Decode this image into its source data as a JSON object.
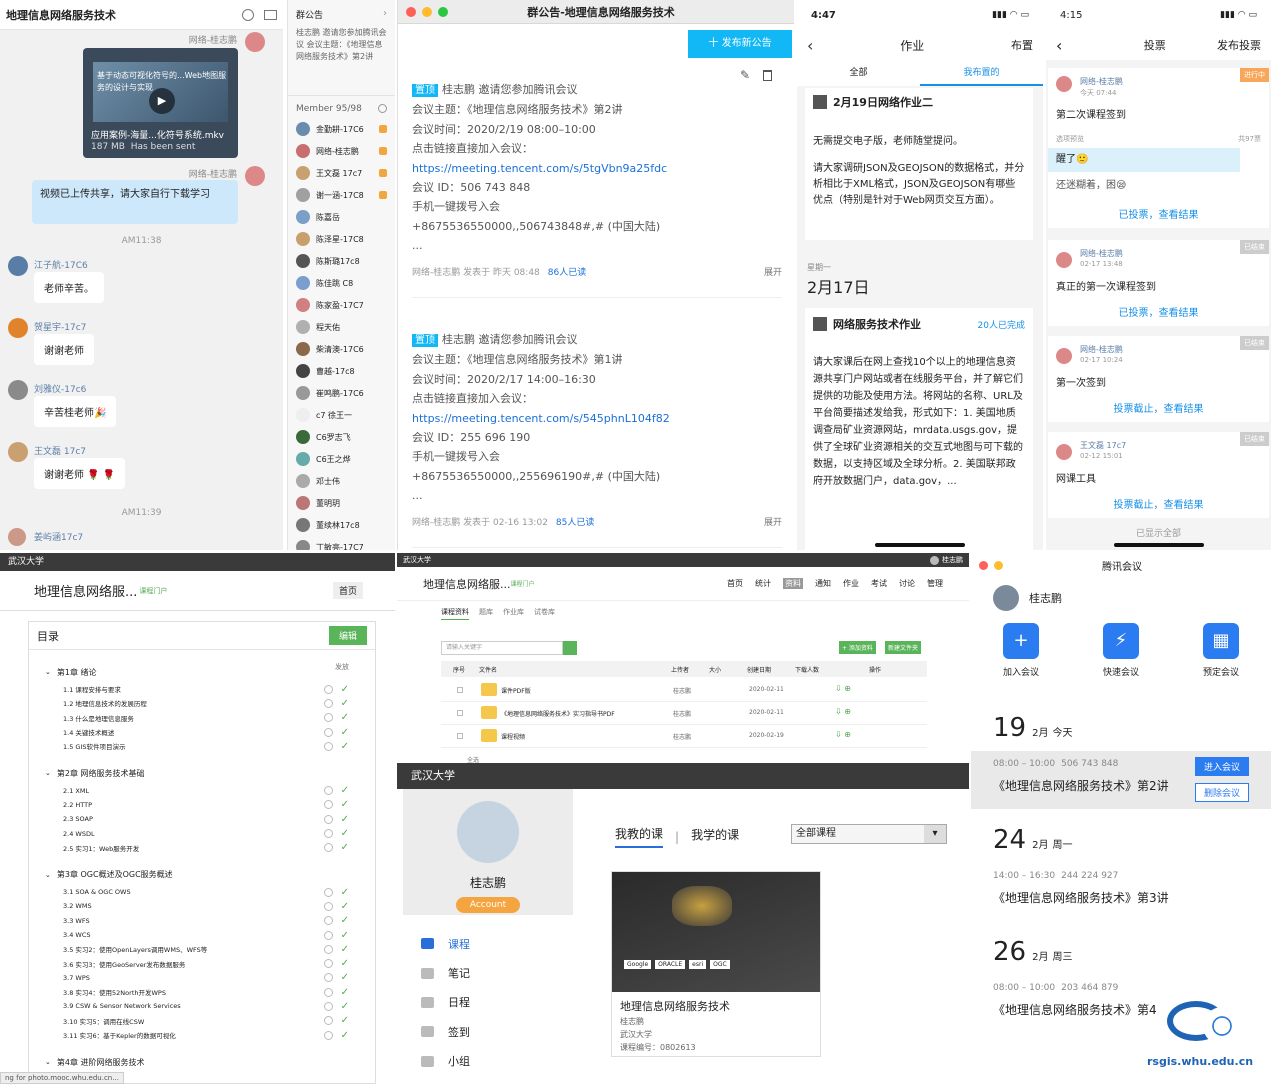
{
  "chat": {
    "title": "地理信息网络服务技术",
    "sender1": "网络-桂志鹏",
    "video_overlay": "基于动态可视化符号的...Web地图服务的设计与实现",
    "video_name": "应用案例-海量...化符号系统.mkv",
    "video_size": "187 MB",
    "video_status": "Has been sent",
    "sender2": "网络-桂志鹏",
    "msg1": "视频已上传共享，请大家自行下载学习",
    "time1": "AM11:38",
    "msgs": [
      {
        "name": "江子航-17C6",
        "text": "老师辛苦。",
        "color": "#5a7da8"
      },
      {
        "name": "贺星宇-17c7",
        "text": "谢谢老师",
        "color": "#e0842c"
      },
      {
        "name": "刘雅仪-17c6",
        "text": "辛苦桂老师🎉",
        "color": "#8a8a8a"
      },
      {
        "name": "王文磊 17c7",
        "text": "谢谢老师 🌹 🌹",
        "color": "#c9a070"
      }
    ],
    "time2": "AM11:39",
    "last_name": "姜屿涵17c7"
  },
  "members": {
    "title": "群公告",
    "notice": "桂志鹏 邀请您参加腾讯会议 会议主题：《地理信息网络服务技术》第2讲",
    "count_label": "Member 95/98",
    "list": [
      {
        "name": "金勤耕-17C6",
        "c": "#6b8cae",
        "crown": true
      },
      {
        "name": "网络-桂志鹏",
        "c": "#c86e6e",
        "crown": true
      },
      {
        "name": "王文磊 17c7",
        "c": "#c9a070",
        "crown": true
      },
      {
        "name": "谢一涵-17C8",
        "c": "#a0a0a0",
        "crown": true
      },
      {
        "name": "陈嘉岳",
        "c": "#7aa0c8",
        "crown": false
      },
      {
        "name": "陈泽星-17C8",
        "c": "#c8a06e",
        "crown": false
      },
      {
        "name": "陈斯璐17c8",
        "c": "#555",
        "crown": false
      },
      {
        "name": "陈佳跳 C8",
        "c": "#7a9ecf",
        "crown": false
      },
      {
        "name": "陈家盈-17C7",
        "c": "#d08080",
        "crown": false
      },
      {
        "name": "程天佑",
        "c": "#b0b0b0",
        "crown": false
      },
      {
        "name": "柴清澳-17C6",
        "c": "#8a6a4a",
        "crown": false
      },
      {
        "name": "曹越-17c8",
        "c": "#444",
        "crown": false
      },
      {
        "name": "崔鸣鹏-17C6",
        "c": "#999",
        "crown": false
      },
      {
        "name": "c7 徐王一",
        "c": "#eee",
        "crown": false
      },
      {
        "name": "C6罗志飞",
        "c": "#3a6a3a",
        "crown": false
      },
      {
        "name": "C6王之烨",
        "c": "#6aa",
        "crown": false
      },
      {
        "name": "邓士伟",
        "c": "#aaa",
        "crown": false
      },
      {
        "name": "董明玥",
        "c": "#b77",
        "crown": false
      },
      {
        "name": "董续林17c8",
        "c": "#777",
        "crown": false
      },
      {
        "name": "丁敏亮-17C7",
        "c": "#888",
        "crown": false
      }
    ]
  },
  "announce": {
    "title": "群公告-地理信息网络服务技术",
    "publish_btn": "十 发布新公告",
    "items": [
      {
        "pin": "置顶",
        "head": "桂志鹏 邀请您参加腾讯会议",
        "topic": "会议主题：《地理信息网络服务技术》第2讲",
        "time": "会议时间：2020/2/19 08:00–10:00",
        "join": "点击链接直接加入会议：",
        "link": "https://meeting.tencent.com/s/5tgVbn9a25fdc",
        "id": "会议 ID：506 743 848",
        "phone": "手机一键拨号入会",
        "num": "+8675536550000,,506743848#,# (中国大陆)",
        "more": "...",
        "footer": "网络-桂志鹏 发表于 昨天 08:48",
        "read": "86人已读",
        "expand": "展开"
      },
      {
        "pin": "置顶",
        "head": "桂志鹏 邀请您参加腾讯会议",
        "topic": "会议主题：《地理信息网络服务技术》第1讲",
        "time": "会议时间：2020/2/17 14:00–16:30",
        "join": "点击链接直接加入会议：",
        "link": "https://meeting.tencent.com/s/545phnL104f82",
        "id": "会议 ID：255 696 190",
        "phone": "手机一键拨号入会",
        "num": "+8675536550000,,255696190#,# (中国大陆)",
        "more": "...",
        "footer": "网络-桂志鹏 发表于 02-16 13:02",
        "read": "85人已读",
        "expand": "展开"
      }
    ]
  },
  "homework": {
    "time": "4:47",
    "title": "作业",
    "right": "布置",
    "tab_all": "全部",
    "tab_mine": "我布置的",
    "card1_title": "2月19日网络作业二",
    "card1_p1": "无需提交电子版，老师随堂提问。",
    "card1_p2": "请大家调研JSON及GEOJSON的数据格式，并分析相比于XML格式，JSON及GEOJSON有哪些优点（特别是针对于Web网页交互方面）。",
    "weekday": "星期一",
    "date": "2月17日",
    "card2_title": "网络服务技术作业",
    "card2_done": "20人已完成",
    "card2_body": "请大家课后在网上查找10个以上的地理信息资源共享门户网站或者在线服务平台，并了解它们提供的功能及使用方法。将网站的名称、URL及平台简要描述发给我，形式如下：1. 美国地质调查局矿业资源网站，mrdata.usgs.gov，提供了全球矿业资源相关的交互式地图与可下载的数据，以支持区域及全球分析。2. 美国联邦政府开放数据门户，data.gov，..."
  },
  "vote": {
    "time": "4:15",
    "title": "投票",
    "right": "发布投票",
    "v1_author": "网络-桂志鹏",
    "v1_time": "今天 07:44",
    "v1_status": "进行中",
    "v1_title": "第二次课程签到",
    "v1_preview": "选项预览",
    "v1_total": "共97票",
    "v1_opt1": "醒了🙂",
    "v1_opt2": "还迷糊着，困😪",
    "v1_link": "已投票，查看结果",
    "items": [
      {
        "author": "网络-桂志鹏",
        "time": "02-17 13:48",
        "status": "已结束",
        "title": "真正的第一次课程签到",
        "link": "已投票，查看结果"
      },
      {
        "author": "网络-桂志鹏",
        "time": "02-17 10:24",
        "status": "已结束",
        "title": "第一次签到",
        "link": "投票截止，查看结果"
      },
      {
        "author": "王文磊 17c7",
        "time": "02-12 15:01",
        "status": "已结束",
        "title": "网课工具",
        "link": "投票截止，查看结果"
      }
    ],
    "shown_all": "已显示全部"
  },
  "outline": {
    "school": "武汉大学",
    "course": "地理信息网络服...",
    "course_tag": "课程门户",
    "home": "首页",
    "toc": "目录",
    "edit": "编辑",
    "publish_col": "发放",
    "chapters": [
      {
        "title": "第1章 绪论",
        "items": [
          "1.1 课程安排与要求",
          "1.2 地理信息技术的发展历程",
          "1.3 什么是地理信息服务",
          "1.4 关键技术概述",
          "1.5 GIS软件项目演示"
        ]
      },
      {
        "title": "第2章 网络服务技术基础",
        "items": [
          "2.1 XML",
          "2.2 HTTP",
          "2.3 SOAP",
          "2.4 WSDL",
          "2.5 实习1：Web服务开发"
        ]
      },
      {
        "title": "第3章 OGC概述及OGC服务概述",
        "items": [
          "3.1 SOA & OGC OWS",
          "3.2 WMS",
          "3.3 WFS",
          "3.4 WCS",
          "3.5 实习2：使用OpenLayers调用WMS、WFS等",
          "3.6 实习3：使用GeoServer发布数据服务",
          "3.7 WPS",
          "3.8 实习4：使用52North开发WPS",
          "3.9 CSW & Sensor Network Services",
          "3.10 实习5：调用在线CSW",
          "3.11 实习6：基于Kepler的数据可视化"
        ]
      },
      {
        "title": "第4章 进阶网络服务技术",
        "items": []
      }
    ],
    "status": "ng for photo.mooc.whu.edu.cn..."
  },
  "files": {
    "school": "武汉大学",
    "user": "桂志鹏",
    "course": "地理信息网络服...",
    "course_tag": "课程门户",
    "nav": [
      "首页",
      "统计",
      "资料",
      "通知",
      "作业",
      "考试",
      "讨论",
      "管理"
    ],
    "subtabs": [
      "课程资料",
      "题库",
      "作业库",
      "试卷库"
    ],
    "search_ph": "请输入关键字",
    "btn_add": "+ 添加资料",
    "btn_new": "新建文件夹",
    "cols": [
      "序号",
      "文件名",
      "上传者",
      "大小",
      "创建日期",
      "下载人数",
      "操作"
    ],
    "rows": [
      {
        "name": "课件PDF版",
        "up": "桂志鹏",
        "date": "2020-02-11"
      },
      {
        "name": "《地理信息网络服务技术》实习指导书PDF",
        "up": "桂志鹏",
        "date": "2020-02-11"
      },
      {
        "name": "课程视频",
        "up": "桂志鹏",
        "date": "2020-02-19"
      }
    ],
    "bottom": "全选"
  },
  "portal": {
    "school": "武汉大学",
    "name": "桂志鹏",
    "account": "Account",
    "menu": [
      "课程",
      "笔记",
      "日程",
      "签到",
      "小组"
    ],
    "tab_teach": "我教的课",
    "tab_learn": "我学的课",
    "filter": "全部课程",
    "card_title": "地理信息网络服务技术",
    "card_teacher": "桂志鹏",
    "card_school": "武汉大学",
    "card_code": "课程编号：0802613",
    "card_logos": [
      "Google",
      "ORACLE",
      "esri",
      "OGC"
    ]
  },
  "meeting": {
    "title": "腾讯会议",
    "user": "桂志鹏",
    "actions": [
      "加入会议",
      "快速会议",
      "预定会议"
    ],
    "days": [
      {
        "d": "19",
        "m": "2月",
        "w": "今天",
        "time": "08:00 – 10:00",
        "id": "506 743 848",
        "name": "《地理信息网络服务技术》第2讲",
        "enter": "进入会议",
        "del": "删除会议"
      },
      {
        "d": "24",
        "m": "2月",
        "w": "周一",
        "time": "14:00 – 16:30",
        "id": "244 224 927",
        "name": "《地理信息网络服务技术》第3讲"
      },
      {
        "d": "26",
        "m": "2月",
        "w": "周三",
        "time": "08:00 – 10:00",
        "id": "203 464 879",
        "name": "《地理信息网络服务技术》第4"
      }
    ],
    "watermark": "rsgis.whu.edu.cn"
  }
}
